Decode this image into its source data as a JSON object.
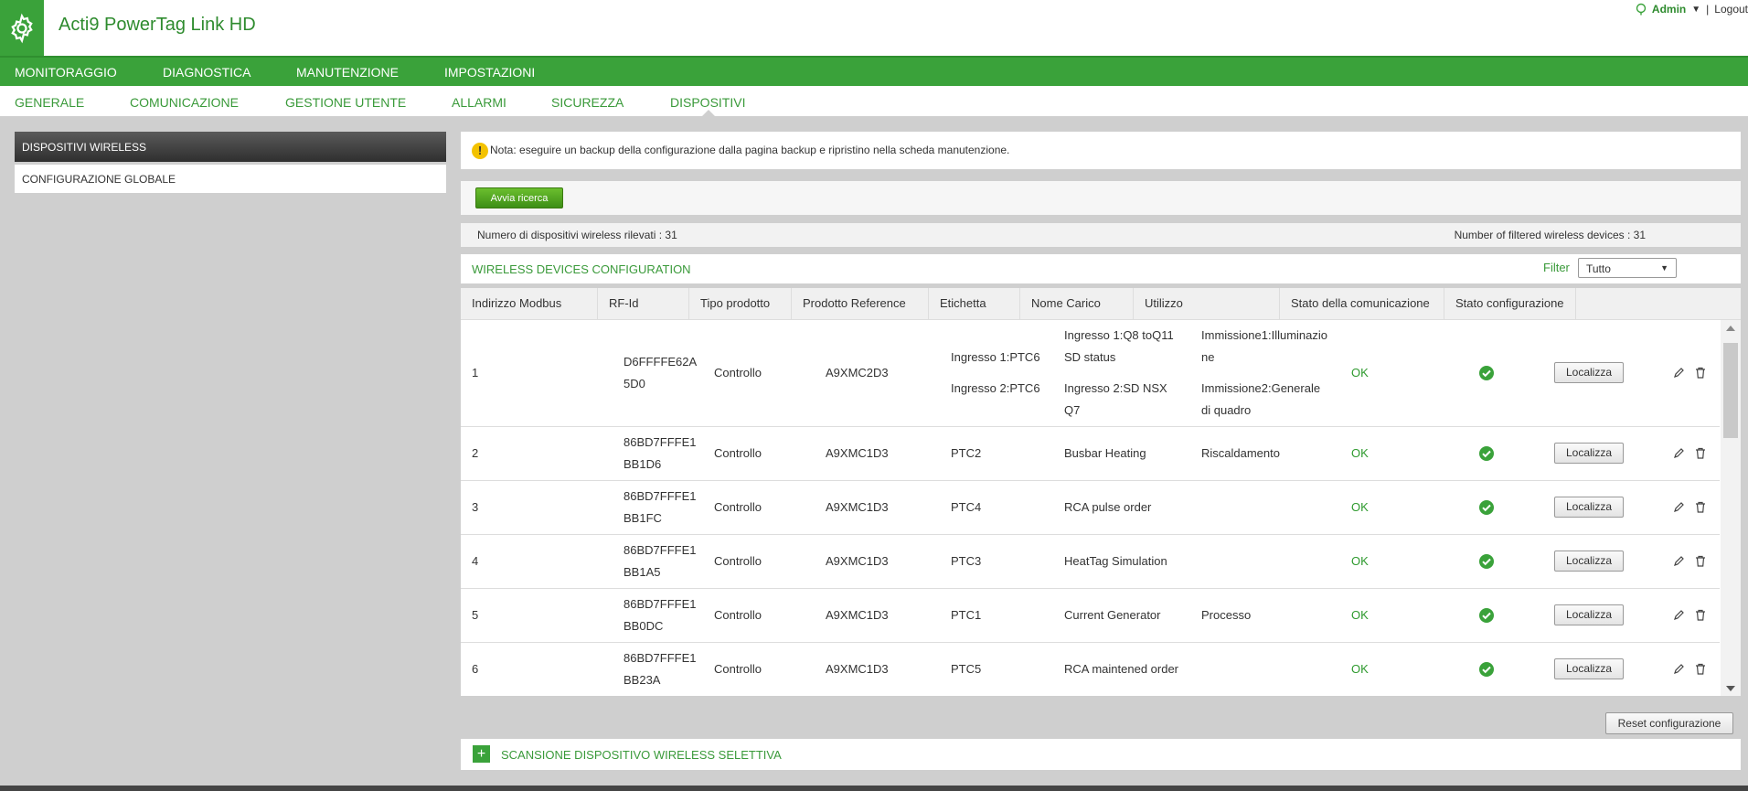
{
  "header": {
    "title": "Acti9 PowerTag Link HD",
    "user": "Admin",
    "separator": "|",
    "logout": "Logout",
    "logo_icon": "gear-icon",
    "user_icon": "user-icon",
    "accent": "#3aa23a"
  },
  "main_nav": [
    "MONITORAGGIO",
    "DIAGNOSTICA",
    "MANUTENZIONE",
    "IMPOSTAZIONI"
  ],
  "sub_nav": [
    "GENERALE",
    "COMUNICAZIONE",
    "GESTIONE UTENTE",
    "ALLARMI",
    "SICUREZZA",
    "DISPOSITIVI"
  ],
  "sidebar": {
    "active": "DISPOSITIVI WIRELESS",
    "item": "CONFIGURAZIONE GLOBALE"
  },
  "note": {
    "icon": "!",
    "text": "Nota: eseguire un backup della configurazione dalla pagina backup e ripristino nella scheda manutenzione."
  },
  "search": {
    "button": "Avvia ricerca"
  },
  "counts": {
    "detected": "Numero di dispositivi wireless rilevati : 31",
    "filtered": "Number of filtered wireless devices : 31"
  },
  "config": {
    "title": "WIRELESS DEVICES CONFIGURATION",
    "filter_label": "Filter",
    "filter_value": "Tutto"
  },
  "table": {
    "columns": [
      "Indirizzo Modbus",
      "RF-Id",
      "Tipo prodotto",
      "Prodotto Reference",
      "Etichetta",
      "Nome Carico",
      "Utilizzo",
      "Stato della comunicazione",
      "Stato configurazione"
    ],
    "locate_label": "Localizza",
    "rows": [
      {
        "modbus": "1",
        "rf1": "D6FFFFE62A",
        "rf2": "5D0",
        "tipo": "Controllo",
        "ref": "A9XMC2D3",
        "etichetta1": "Ingresso 1:PTC6",
        "etichetta2": "Ingresso 2:PTC6",
        "carico1": "Ingresso 1:Q8 toQ11",
        "carico2": "SD status",
        "carico3": "Ingresso 2:SD NSX",
        "carico4": "Q7",
        "utilizzo1": "Immissione1:Illuminazio",
        "utilizzo2": "ne",
        "utilizzo3": "Immissione2:Generale",
        "utilizzo4": "di quadro",
        "comm": "OK"
      },
      {
        "modbus": "2",
        "rf1": "86BD7FFFE1",
        "rf2": "BB1D6",
        "tipo": "Controllo",
        "ref": "A9XMC1D3",
        "etichetta": "PTC2",
        "carico": "Busbar Heating",
        "utilizzo": "Riscaldamento",
        "comm": "OK"
      },
      {
        "modbus": "3",
        "rf1": "86BD7FFFE1",
        "rf2": "BB1FC",
        "tipo": "Controllo",
        "ref": "A9XMC1D3",
        "etichetta": "PTC4",
        "carico": "RCA pulse order",
        "utilizzo": "",
        "comm": "OK"
      },
      {
        "modbus": "4",
        "rf1": "86BD7FFFE1",
        "rf2": "BB1A5",
        "tipo": "Controllo",
        "ref": "A9XMC1D3",
        "etichetta": "PTC3",
        "carico": "HeatTag Simulation",
        "utilizzo": "",
        "comm": "OK"
      },
      {
        "modbus": "5",
        "rf1": "86BD7FFFE1",
        "rf2": "BB0DC",
        "tipo": "Controllo",
        "ref": "A9XMC1D3",
        "etichetta": "PTC1",
        "carico": "Current Generator",
        "utilizzo": "Processo",
        "comm": "OK"
      },
      {
        "modbus": "6",
        "rf1": "86BD7FFFE1",
        "rf2": "BB23A",
        "tipo": "Controllo",
        "ref": "A9XMC1D3",
        "etichetta": "PTC5",
        "carico": "RCA maintened order",
        "utilizzo": "",
        "comm": "OK"
      }
    ]
  },
  "reset_button": "Reset configurazione",
  "scan": {
    "plus": "+",
    "label": "SCANSIONE DISPOSITIVO WIRELESS SELETTIVA"
  }
}
